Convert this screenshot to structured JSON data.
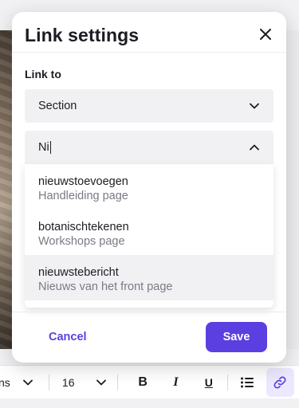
{
  "modal": {
    "title": "Link settings",
    "link_to_label": "Link to",
    "link_type": {
      "selected": "Section"
    },
    "search": {
      "value": "Ni",
      "results": [
        {
          "name": "nieuwstoevoegen",
          "subtitle": "Handleiding page"
        },
        {
          "name": "botanischtekenen",
          "subtitle": "Workshops page"
        },
        {
          "name": "nieuwstebericht",
          "subtitle": "Nieuws van het front page"
        }
      ]
    },
    "footer": {
      "cancel_label": "Cancel",
      "save_label": "Save"
    }
  },
  "toolbar": {
    "font_family_partial": "ns",
    "font_size": "16",
    "bold_label": "B",
    "italic_label": "I",
    "underline_label": "U"
  },
  "colors": {
    "accent": "#5b3fe0",
    "field_bg": "#f1f1f4",
    "active_tool_bg": "#ece8ff"
  }
}
